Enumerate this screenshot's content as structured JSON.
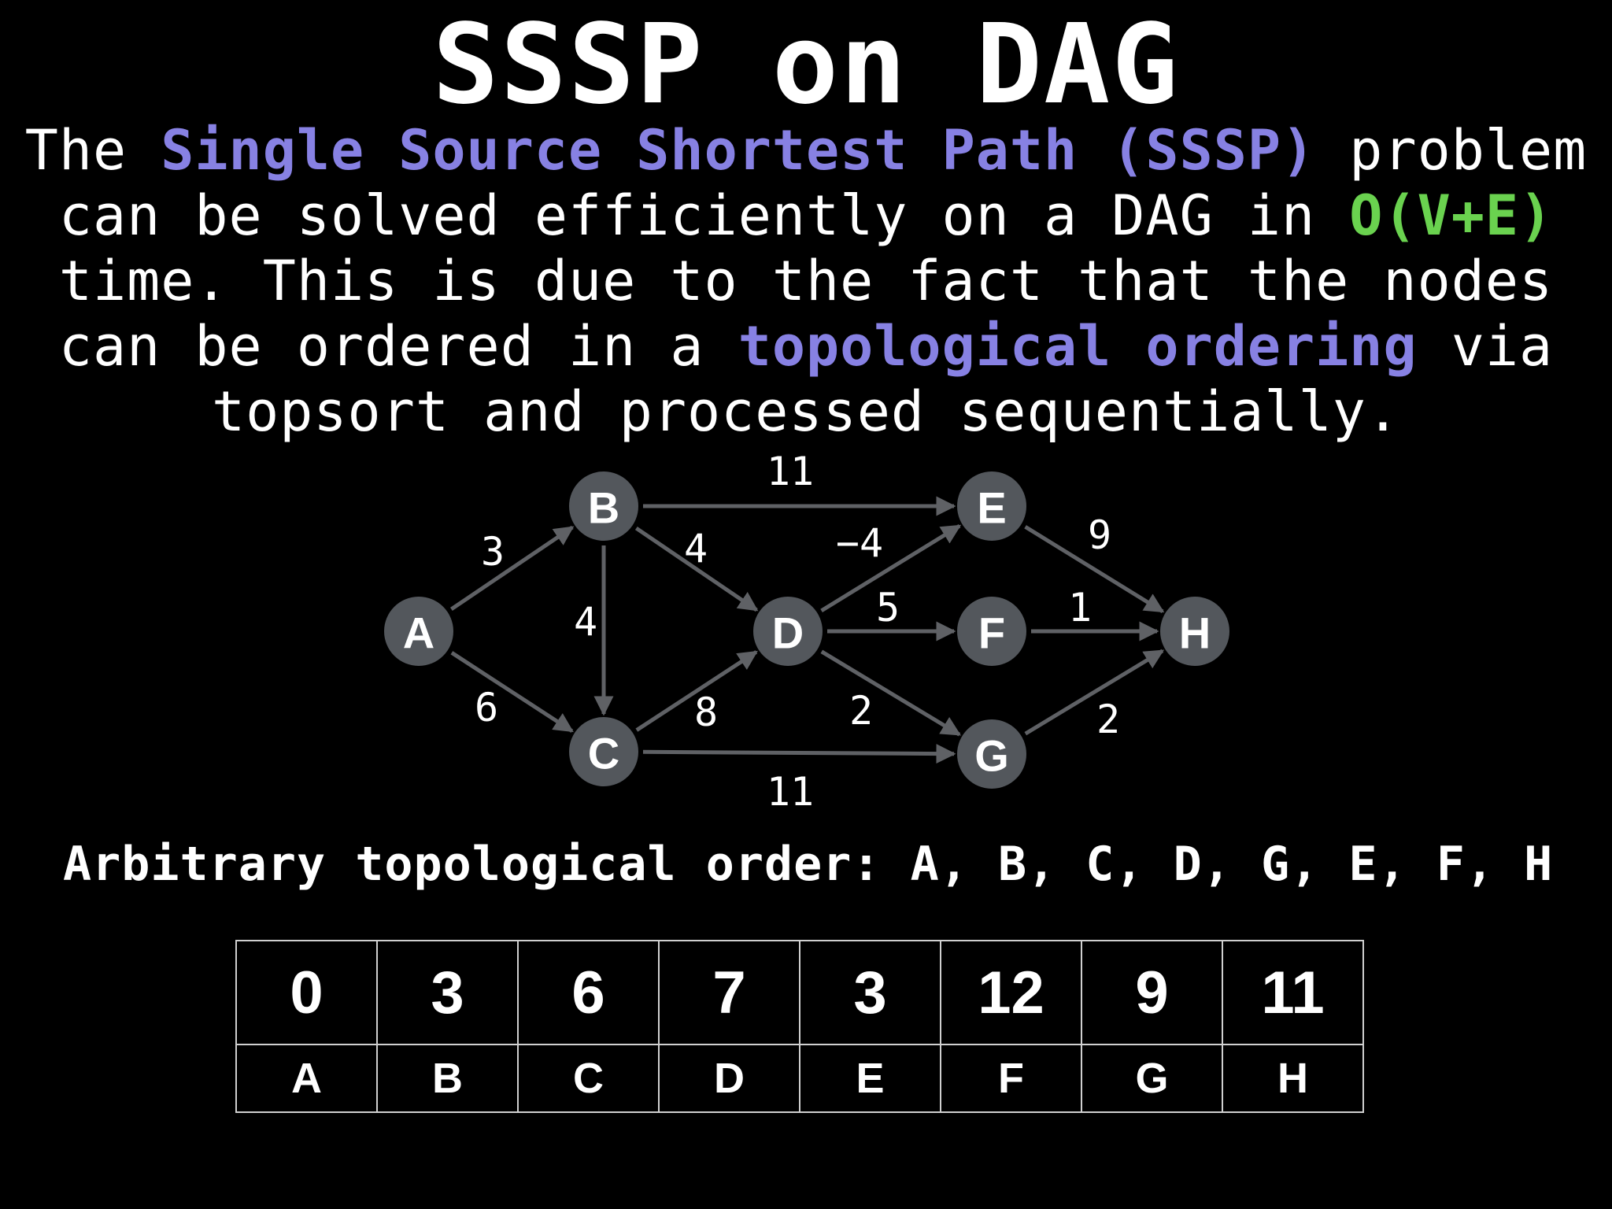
{
  "title": "SSSP on DAG",
  "intro": {
    "line1_a": "The ",
    "line1_b": "Single Source Shortest Path (SSSP)",
    "line1_c": " problem",
    "line2_a": "can be solved efficiently on a DAG in ",
    "line2_b": "O(V+E)",
    "line3": "time. This is due to the fact that the nodes",
    "line4_a": "can be ordered in a ",
    "line4_b": "topological ordering",
    "line4_c": " via",
    "line5": "topsort and processed sequentially."
  },
  "colors": {
    "highlight_purple": "#8781e3",
    "highlight_green": "#6ad24f",
    "node_fill": "#53575c",
    "edge": "#5f6165"
  },
  "graph": {
    "nodes": [
      {
        "id": "A",
        "label": "A"
      },
      {
        "id": "B",
        "label": "B"
      },
      {
        "id": "C",
        "label": "C"
      },
      {
        "id": "D",
        "label": "D"
      },
      {
        "id": "E",
        "label": "E"
      },
      {
        "id": "F",
        "label": "F"
      },
      {
        "id": "G",
        "label": "G"
      },
      {
        "id": "H",
        "label": "H"
      }
    ],
    "edges": [
      {
        "from": "A",
        "to": "B",
        "weight": "3"
      },
      {
        "from": "A",
        "to": "C",
        "weight": "6"
      },
      {
        "from": "B",
        "to": "C",
        "weight": "4"
      },
      {
        "from": "B",
        "to": "D",
        "weight": "4"
      },
      {
        "from": "B",
        "to": "E",
        "weight": "11"
      },
      {
        "from": "C",
        "to": "D",
        "weight": "8"
      },
      {
        "from": "C",
        "to": "G",
        "weight": "11"
      },
      {
        "from": "D",
        "to": "E",
        "weight": "−4"
      },
      {
        "from": "D",
        "to": "F",
        "weight": "5"
      },
      {
        "from": "D",
        "to": "G",
        "weight": "2"
      },
      {
        "from": "E",
        "to": "H",
        "weight": "9"
      },
      {
        "from": "F",
        "to": "H",
        "weight": "1"
      },
      {
        "from": "G",
        "to": "H",
        "weight": "2"
      }
    ]
  },
  "order_text": "Arbitrary topological order: A, B, C, D, G, E, F, H",
  "table": {
    "values": [
      "0",
      "3",
      "6",
      "7",
      "3",
      "12",
      "9",
      "11"
    ],
    "names": [
      "A",
      "B",
      "C",
      "D",
      "E",
      "F",
      "G",
      "H"
    ]
  }
}
